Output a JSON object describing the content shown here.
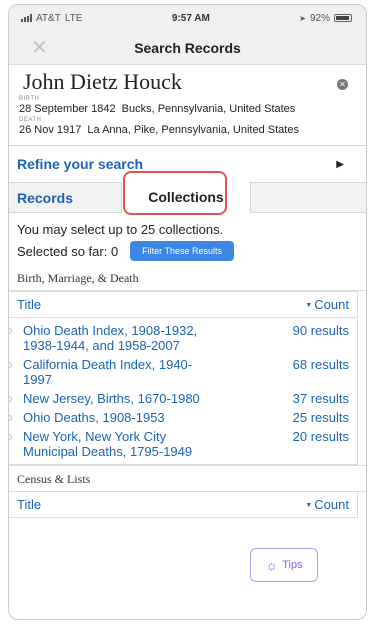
{
  "status_bar": {
    "carrier": "AT&T",
    "network": "LTE",
    "time": "9:57 AM",
    "battery": "92%"
  },
  "nav": {
    "title": "Search Records",
    "close_icon": "close-icon"
  },
  "person": {
    "name": "John Dietz Houck",
    "birth_label": "BIRTH",
    "birth_date": "28 September 1842",
    "birth_place": "Bucks, Pennsylvania, United States",
    "death_label": "DEATH",
    "death_date": "26 Nov 1917",
    "death_place": "La Anna, Pike, Pennsylvania, United States"
  },
  "refine": {
    "label": "Refine your search"
  },
  "tabs": [
    {
      "label": "Records",
      "active": false
    },
    {
      "label": "Collections",
      "active": true
    }
  ],
  "collections": {
    "limit_text": "You may select up to 25 collections.",
    "selected_text": "Selected so far: 0",
    "filter_button": "Filter These Results"
  },
  "sections": [
    {
      "label": "Birth, Marriage, & Death",
      "header_title": "Title",
      "header_count": "Count",
      "rows": [
        {
          "title": "Ohio Death Index, 1908-1932, 1938-1944, and 1958-2007",
          "count": "90 results"
        },
        {
          "title": "California Death Index, 1940-1997",
          "count": "68 results"
        },
        {
          "title": "New Jersey, Births, 1670-1980",
          "count": "37 results"
        },
        {
          "title": "Ohio Deaths, 1908-1953",
          "count": "25 results"
        },
        {
          "title": "New York, New York City Municipal Deaths, 1795-1949",
          "count": "20 results"
        }
      ]
    },
    {
      "label": "Census & Lists",
      "header_title": "Title",
      "header_count": "Count",
      "rows": []
    }
  ],
  "tips": {
    "label": "Tips"
  },
  "colors": {
    "link": "#1d63b5",
    "button": "#3d86e6",
    "highlight": "#e0574f",
    "tips": "#8b63e6"
  }
}
